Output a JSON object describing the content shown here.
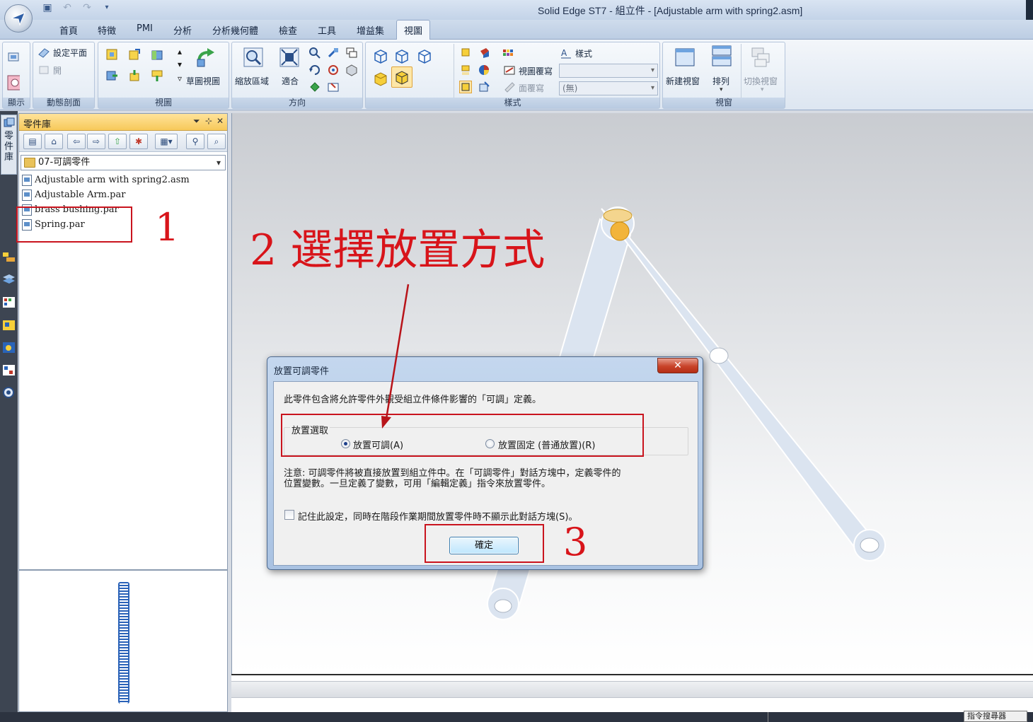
{
  "window": {
    "title": "Solid Edge ST7 - 組立件 - [Adjustable arm with spring2.asm]"
  },
  "tabs": [
    "首頁",
    "特徵",
    "PMI",
    "分析",
    "分析幾何體",
    "檢查",
    "工具",
    "增益集",
    "視圖"
  ],
  "active_tab": "視圖",
  "ribbon": {
    "groups": {
      "show": "顯示",
      "dynamic_section": "動態剖面",
      "views": "視圖",
      "orient": "方向",
      "style": "樣式",
      "window": "視窗"
    },
    "set_plane": "設定平面",
    "open": "開",
    "sketch_view": "草圖視圖",
    "zoom_area": "縮放區域",
    "fit": "適合",
    "style_label": "樣式",
    "view_overlay": "視圖覆寫",
    "face_overlay": "面覆寫",
    "face_overlay_value": "(無)",
    "new_window": "新建視窗",
    "arrange": "排列",
    "switch_window": "切換視窗"
  },
  "left_strip": {
    "parts_library_tab": "零件庫"
  },
  "parts_library": {
    "title": "零件庫",
    "folder": "07-可調零件",
    "files": [
      "Adjustable arm with spring2.asm",
      "Adjustable Arm.par",
      "brass bushing.par",
      "Spring.par"
    ]
  },
  "status": {
    "command_finder": "指令搜尋器"
  },
  "annotations": {
    "step1": "1",
    "step2": "2 選擇放置方式",
    "step3": "3"
  },
  "dialog": {
    "title": "放置可調零件",
    "close_symbol": "✕",
    "intro": "此零件包含將允許零件外觀受組立件條件影響的「可調」定義。",
    "group_label": "放置選取",
    "option_adjustable": "放置可調(A)",
    "option_rigid": "放置固定 (普通放置)(R)",
    "selected_option": "option_adjustable",
    "note_line1": "注意: 可調零件將被直接放置到組立件中。在「可調零件」對話方塊中，定義零件的",
    "note_line2": "位置變數。一旦定義了變數，可用「編輯定義」指令來放置零件。",
    "remember_label": "記住此設定，同時在階段作業期間放置零件時不顯示此對話方塊(S)。",
    "remember_checked": false,
    "ok_label": "確定"
  },
  "colors": {
    "annotation_red": "#d8141a",
    "arm_fill": "#dbe4f0",
    "pivot_yellow": "#f2b43a",
    "panel_header": "#f7c95a"
  }
}
